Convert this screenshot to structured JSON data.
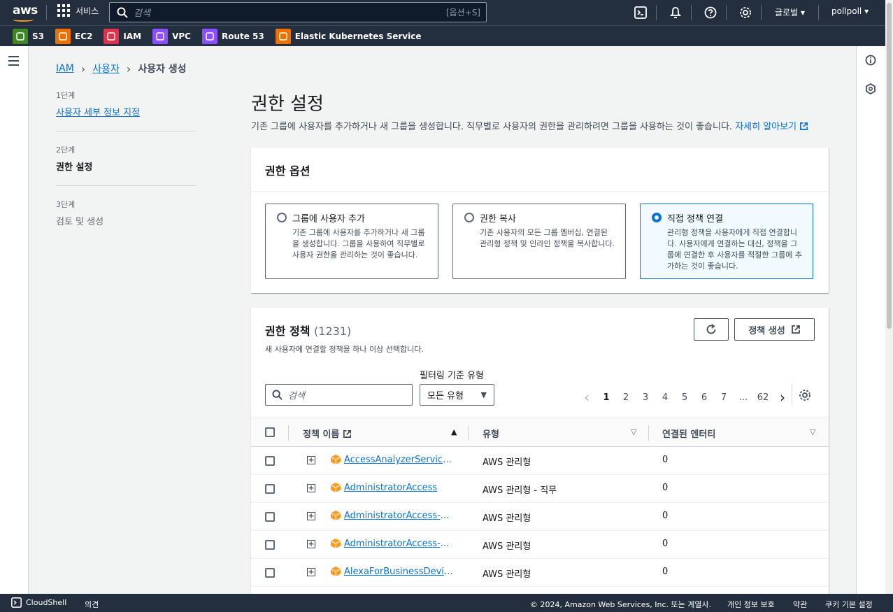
{
  "topnav": {
    "logo": "aws",
    "services_label": "서비스",
    "search_placeholder": "검색",
    "search_shortcut": "[옵션+S]",
    "region": "글로벌",
    "account": "pollpoll"
  },
  "favorites": [
    {
      "label": "S3",
      "color": "#3f8624"
    },
    {
      "label": "EC2",
      "color": "#ed7100"
    },
    {
      "label": "IAM",
      "color": "#dd344c"
    },
    {
      "label": "VPC",
      "color": "#8c4fff"
    },
    {
      "label": "Route 53",
      "color": "#8c4fff"
    },
    {
      "label": "Elastic Kubernetes Service",
      "color": "#ed7100"
    }
  ],
  "breadcrumb": {
    "items": [
      "IAM",
      "사용자"
    ],
    "current": "사용자 생성"
  },
  "steps": [
    {
      "num": "1단계",
      "title": "사용자 세부 정보 지정"
    },
    {
      "num": "2단계",
      "title": "권한 설정"
    },
    {
      "num": "3단계",
      "title": "검토 및 생성"
    }
  ],
  "page": {
    "title": "권한 설정",
    "description": "기존 그룹에 사용자를 추가하거나 새 그룹을 생성합니다. 직무별로 사용자의 권한을 관리하려면 그룹을 사용하는 것이 좋습니다.",
    "learn_more": "자세히 알아보기"
  },
  "options_panel": {
    "title": "권한 옵션",
    "tiles": [
      {
        "title": "그룹에 사용자 추가",
        "desc": "기존 그룹에 사용자를 추가하거나 새 그룹을 생성합니다. 그룹을 사용하여 직무별로 사용자 권한을 관리하는 것이 좋습니다."
      },
      {
        "title": "권한 복사",
        "desc": "기존 사용자의 모든 그룹 멤버십, 연결된 관리형 정책 및 인라인 정책을 복사합니다."
      },
      {
        "title": "직접 정책 연결",
        "desc": "관리형 정책을 사용자에게 직접 연결합니다. 사용자에게 연결하는 대신, 정책을 그룹에 연결한 후 사용자를 적절한 그룹에 추가하는 것이 좋습니다."
      }
    ],
    "selected_index": 2
  },
  "policies_panel": {
    "title": "권한 정책",
    "count": "(1231)",
    "description": "새 사용자에 연결할 정책을 하나 이상 선택합니다.",
    "create_button": "정책 생성",
    "filter_label": "필터링 기준 유형",
    "search_placeholder": "검색",
    "type_select": "모든 유형",
    "pages": [
      "1",
      "2",
      "3",
      "4",
      "5",
      "6",
      "7",
      "...",
      "62"
    ],
    "current_page": "1",
    "columns": [
      "정책 이름",
      "유형",
      "연결된 엔터티"
    ],
    "rows": [
      {
        "name": "AccessAnalyzerServiceRolePolicy",
        "type": "AWS 관리형",
        "entities": "0"
      },
      {
        "name": "AdministratorAccess",
        "type": "AWS 관리형 - 직무",
        "entities": "0"
      },
      {
        "name": "AdministratorAccess-Amplify",
        "type": "AWS 관리형",
        "entities": "0"
      },
      {
        "name": "AdministratorAccess-AWSElasticBeanstalk",
        "type": "AWS 관리형",
        "entities": "0"
      },
      {
        "name": "AlexaForBusinessDeviceSetup",
        "type": "AWS 관리형",
        "entities": "0"
      }
    ]
  },
  "footer": {
    "cloudshell": "CloudShell",
    "feedback": "의견",
    "copyright": "© 2024, Amazon Web Services, Inc. 또는 계열사.",
    "privacy": "개인 정보 보호",
    "terms": "약관",
    "cookies": "쿠키 기본 설정"
  }
}
